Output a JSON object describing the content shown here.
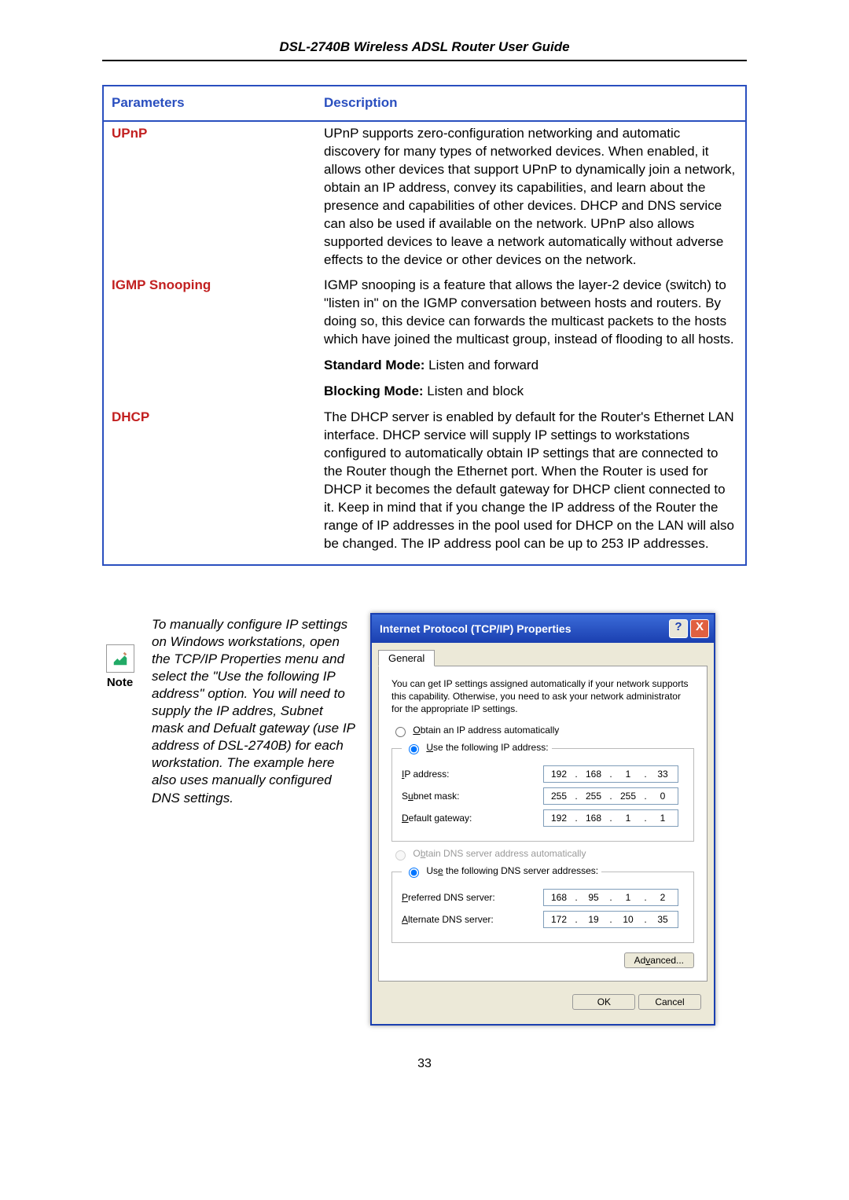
{
  "doc_title": "DSL-2740B Wireless ADSL Router User Guide",
  "page_number": "33",
  "table": {
    "header_param": "Parameters",
    "header_desc": "Description",
    "rows": [
      {
        "param": "UPnP",
        "desc": "UPnP supports zero-configuration networking and automatic discovery for many types of networked devices. When enabled, it allows other devices that support UPnP to dynamically join a network, obtain an IP address, convey its capabilities, and learn about the presence and capabilities of other devices. DHCP and DNS service can also be used if available on the network. UPnP also allows supported devices to leave a network automatically without adverse effects to the device or other devices on the network."
      },
      {
        "param": "IGMP Snooping",
        "desc_parts": {
          "p1": "IGMP snooping is a feature that allows the layer-2 device (switch) to \"listen in\" on the IGMP conversation between hosts and routers. By doing so, this device can forwards the multicast packets to the hosts which have joined the multicast group, instead of flooding to all hosts.",
          "std_label": "Standard Mode:",
          "std_text": " Listen and forward",
          "blk_label": "Blocking Mode:",
          "blk_text": "  Listen and block"
        }
      },
      {
        "param": "DHCP",
        "desc": "The DHCP server is enabled by default for the Router's Ethernet LAN interface. DHCP service will supply IP settings to workstations configured to automatically obtain IP settings that are connected to the Router though the Ethernet port. When the Router is used for DHCP it becomes the default gateway for DHCP client connected to it. Keep in mind that if you change the IP address of the Router the range of IP addresses in the pool used for DHCP on the LAN will also be changed. The IP address pool can be up to 253 IP addresses."
      }
    ]
  },
  "note": {
    "label": "Note",
    "text": "To manually configure IP settings on Windows workstations, open the TCP/IP Properties menu and select the \"Use the following IP address\" option. You will need to supply the IP addres, Subnet mask and Defualt gateway (use IP address of DSL-2740B) for each workstation. The example here also uses manually configured DNS settings."
  },
  "dialog": {
    "title": "Internet Protocol (TCP/IP) Properties",
    "help_btn": "?",
    "close_btn": "X",
    "tab": "General",
    "info": "You can get IP settings assigned automatically if your network supports this capability. Otherwise, you need to ask your network administrator for the appropriate IP settings.",
    "radio_obtain_ip": "Obtain an IP address automatically",
    "radio_use_ip": "Use the following IP address:",
    "ip_address_label": "IP address:",
    "ip_address": [
      "192",
      "168",
      "1",
      "33"
    ],
    "subnet_label": "Subnet mask:",
    "subnet": [
      "255",
      "255",
      "255",
      "0"
    ],
    "gateway_label": "Default gateway:",
    "gateway": [
      "192",
      "168",
      "1",
      "1"
    ],
    "radio_obtain_dns": "Obtain DNS server address automatically",
    "radio_use_dns": "Use the following DNS server addresses:",
    "pref_dns_label": "Preferred DNS server:",
    "pref_dns": [
      "168",
      "95",
      "1",
      "2"
    ],
    "alt_dns_label": "Alternate DNS server:",
    "alt_dns": [
      "172",
      "19",
      "10",
      "35"
    ],
    "advanced_btn": "Advanced...",
    "ok_btn": "OK",
    "cancel_btn": "Cancel"
  }
}
